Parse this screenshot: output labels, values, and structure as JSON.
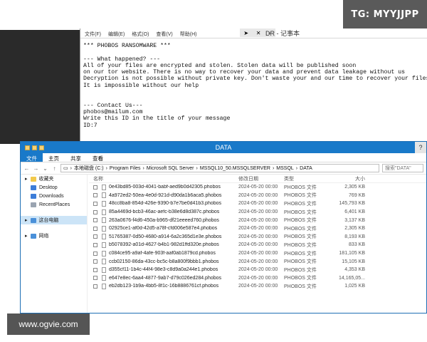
{
  "watermarks": {
    "top": "TG: MYYJJPP",
    "bottom": "www.ogvie.com"
  },
  "notepad": {
    "title": "DR - 记事本",
    "menu": [
      "文件(F)",
      "编辑(E)",
      "格式(O)",
      "查看(V)",
      "帮助(H)"
    ],
    "lines": [
      "*** PHOBOS RANSOMWARE ***",
      "",
      "--- What happened? ---",
      "All of your files are encrypted and stolen. Stolen data will be published soon",
      "on our tor website. There is no way to recover your data and prevent data leakage without us",
      "Decryption is not possible without private key. Don't waste your and our time to recover your files.",
      "It is impossible without our help",
      "",
      "",
      "--- Contact Us---",
      "phobos@mailum.com",
      "Write this ID in the title of your message",
      "ID:7"
    ]
  },
  "explorer": {
    "title": "DATA",
    "ribbon": [
      "文件",
      "主页",
      "共享",
      "查看"
    ],
    "breadcrumb": [
      "本地磁盘 (C:)",
      "Program Files",
      "Microsoft SQL Server",
      "MSSQL10_50.MSSQLSERVER",
      "MSSQL",
      "DATA"
    ],
    "search_placeholder": "搜索\"DATA\"",
    "nav": [
      {
        "label": "收藏夹",
        "kind": "root",
        "icon": "star-icon"
      },
      {
        "label": "Desktop",
        "kind": "sub",
        "icon": "desktop-icon"
      },
      {
        "label": "Downloads",
        "kind": "sub",
        "icon": "downloads-icon"
      },
      {
        "label": "RecentPlaces",
        "kind": "sub",
        "icon": "recent-places-icon"
      },
      {
        "label": "",
        "kind": "gap"
      },
      {
        "label": "这台电脑",
        "kind": "root",
        "icon": "computer-icon",
        "selected": true
      },
      {
        "label": "",
        "kind": "gap"
      },
      {
        "label": "网络",
        "kind": "root",
        "icon": "network-icon"
      }
    ],
    "columns": {
      "name": "名称",
      "date": "修改日期",
      "type": "类型",
      "size": "大小"
    },
    "files": [
      {
        "name": "0e43bd85-003d-4041-babf-aed9b0d42305.phobos",
        "date": "2024-05-20 00:00",
        "type": "PHOBOS 文件",
        "size": "2,305 KB"
      },
      {
        "name": "4a972ed2-50ea-4e0d-921d-d90da1b6aca5.phobos",
        "date": "2024-05-20 00:00",
        "type": "PHOBOS 文件",
        "size": "769 KB"
      },
      {
        "name": "48cc8ba8-854d-426e-9390-b7e7be0d41b3.phobos",
        "date": "2024-05-20 00:00",
        "type": "PHOBOS 文件",
        "size": "145,793 KB"
      },
      {
        "name": "85a4469d-bcb3-46ac-aefc-b38e6d8d387c.phobos",
        "date": "2024-05-20 00:00",
        "type": "PHOBOS 文件",
        "size": "6,401 KB"
      },
      {
        "name": "263a0676-f4d6-450a-b965-df21eeeed760.phobos",
        "date": "2024-05-20 00:00",
        "type": "PHOBOS 文件",
        "size": "3,137 KB"
      },
      {
        "name": "02925ce1-af0d-42d5-a78f-cfd006e587e4.phobos",
        "date": "2024-05-20 00:00",
        "type": "PHOBOS 文件",
        "size": "2,305 KB"
      },
      {
        "name": "51765387-0d50-4680-a914-6a2c365d1e3e.phobos",
        "date": "2024-05-20 00:00",
        "type": "PHOBOS 文件",
        "size": "8,193 KB"
      },
      {
        "name": "b5078392-a01d-4627-b4b1-982d1ffd320e.phobos",
        "date": "2024-05-20 00:00",
        "type": "PHOBOS 文件",
        "size": "833 KB"
      },
      {
        "name": "c084ce95-a9af-4afe-903f-aaf0ab1879cd.phobos",
        "date": "2024-05-20 00:00",
        "type": "PHOBOS 文件",
        "size": "181,105 KB"
      },
      {
        "name": "ccb02150-86da-43cc-bc5c-b8a800f9bbb1.phobos",
        "date": "2024-05-20 00:00",
        "type": "PHOBOS 文件",
        "size": "15,105 KB"
      },
      {
        "name": "d355cf11-1b4c-44f4-98e3-c8d9a0a244e1.phobos",
        "date": "2024-05-20 00:00",
        "type": "PHOBOS 文件",
        "size": "4,353 KB"
      },
      {
        "name": "e647e8ec-6aa4-4877-9ab7-d79c026ed284.phobos",
        "date": "2024-05-20 00:00",
        "type": "PHOBOS 文件",
        "size": "14,165,05..."
      },
      {
        "name": "eb2db123-1b9a-4bb5-8f1c-16b8886761cf.phobos",
        "date": "2024-05-20 00:00",
        "type": "PHOBOS 文件",
        "size": "1,025 KB"
      }
    ]
  }
}
